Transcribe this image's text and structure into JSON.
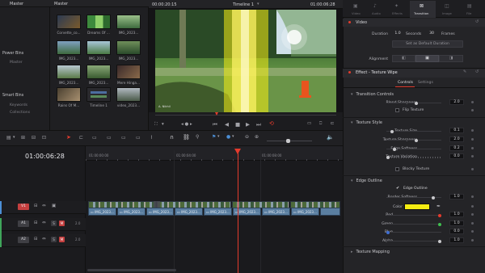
{
  "media_pool": {
    "master_header": "Master",
    "bins_header": "Master",
    "power_bins_title": "Power Bins",
    "power_bins_item": "Master",
    "smart_bins_title": "Smart Bins",
    "smart_bins_items": [
      "Keywords",
      "Collections"
    ],
    "thumbnails": [
      {
        "label": "Corvette_co..."
      },
      {
        "label": "Dreams Of ..."
      },
      {
        "label": "IMG_2023..."
      },
      {
        "label": "IMG_2023..."
      },
      {
        "label": "IMG_2023..."
      },
      {
        "label": "IMG_2023..."
      },
      {
        "label": "IMG_2023..."
      },
      {
        "label": "IMG_2023..."
      },
      {
        "label": "Mere Hinga..."
      },
      {
        "label": "Rains Of M..."
      },
      {
        "label": "Timeline 1"
      },
      {
        "label": "video_2023..."
      }
    ]
  },
  "viewer": {
    "left_timecode": "00:00:20:15",
    "timeline_name": "Timeline 1",
    "right_timecode": "01:00:06:28",
    "watermark": "A. Nikhil"
  },
  "inspector": {
    "tabs": [
      "Video",
      "Audio",
      "Effects",
      "Transition",
      "Image",
      "File"
    ],
    "active_tab": "Transition",
    "video_section": "Video",
    "duration_label": "Duration",
    "duration_seconds": "1.0",
    "seconds_label": "Seconds",
    "duration_frames": "30",
    "frames_label": "Frames",
    "set_default_label": "Set as Default Duration",
    "alignment_label": "Alignment",
    "effect_title": "Effect - Texture Wipe",
    "subtabs": [
      "Controls",
      "Settings"
    ],
    "sections": {
      "transition_controls": "Transition Controls",
      "texture_style": "Texture Style",
      "edge_outline": "Edge Outline",
      "texture_mapping": "Texture Mapping"
    },
    "blend_sharpness": {
      "label": "Blend Sharpness",
      "value": "2.0",
      "level": 0.55
    },
    "flip_texture": "Flip Texture",
    "texture_size": {
      "label": "Texture Size",
      "value": "0.1",
      "level": 0.08
    },
    "texture_sharpness": {
      "label": "Texture Sharpness",
      "value": "2.0",
      "level": 0.55
    },
    "edge_softness": {
      "label": "Edge Softness",
      "value": "0.2",
      "level": 0.12
    },
    "texture_variation": {
      "label": "Texture Variation",
      "value": "0.0",
      "level": 0.0
    },
    "blocky_texture": "Blocky Texture",
    "edge_outline_check": "Edge Outline",
    "border_softness": {
      "label": "Border Softness",
      "value": "1.0",
      "level": 0.88
    },
    "color": {
      "label": "Color",
      "hex": "#f4ec12"
    },
    "red": {
      "label": "Red",
      "value": "1.0",
      "level": 1.0
    },
    "green": {
      "label": "Green",
      "value": "1.0",
      "level": 1.0
    },
    "blue": {
      "label": "Blue",
      "value": "0.0",
      "level": 0.0
    },
    "alpha": {
      "label": "Alpha",
      "value": "1.0",
      "level": 1.0
    }
  },
  "timeline": {
    "timecode": "01:00:06:28",
    "ruler_marks": [
      "01:00:00:00",
      "01:00:04:00",
      "01:00:08:00"
    ],
    "tracks": [
      {
        "name": "V1",
        "type": "video"
      },
      {
        "name": "A1",
        "type": "audio",
        "level": "2.0"
      },
      {
        "name": "A2",
        "type": "audio",
        "level": "2.0"
      }
    ],
    "audio_clips": [
      "IMG_2023...",
      "IMG_2023...",
      "IMG_2023...",
      "IMG_2023...",
      "IMG_2023...",
      "IMG_2023...",
      "IMG_2023...",
      "IMG_2023..."
    ],
    "m_label": "M",
    "s_label": "S"
  },
  "colors": {
    "playhead": "#e53b2d",
    "accent": "#4c8fd6",
    "outline_color": "#f4ec12"
  }
}
